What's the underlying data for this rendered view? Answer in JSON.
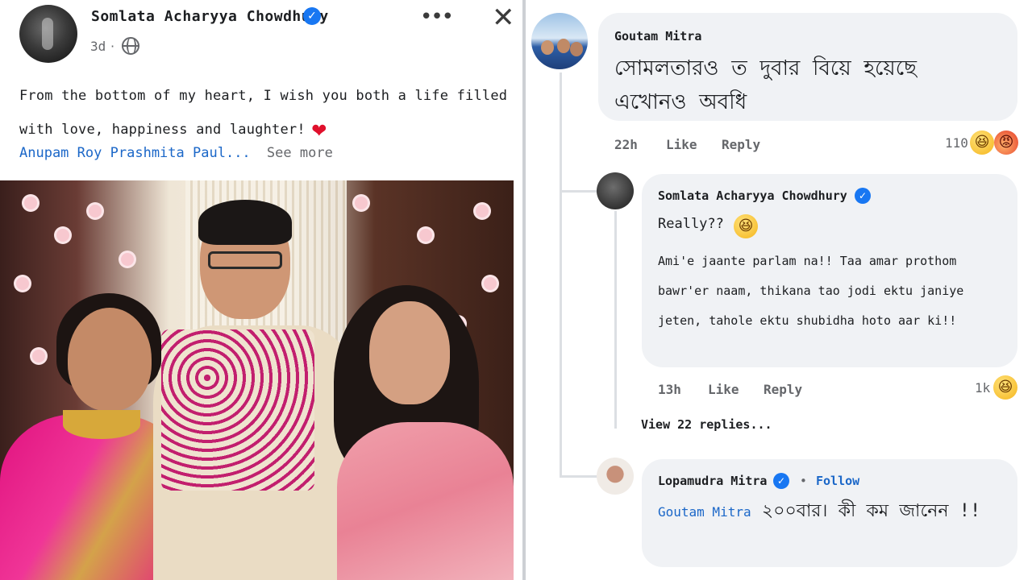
{
  "post": {
    "author": "Somlata Acharyya Chowdhury",
    "time": "3d",
    "separator": "·",
    "text_line1": "From the bottom of my heart, I wish you both a life filled",
    "text_line2": "with love, happiness and laughter!",
    "tag1": "Anupam",
    "tag2": "Roy",
    "tag3": "Prashmita",
    "tag4": "Paul...",
    "see_more": "See more",
    "more_glyph": "•••",
    "close_glyph": "✕",
    "heart_glyph": "❤",
    "verified_glyph": "✓"
  },
  "comments": [
    {
      "author": "Goutam Mitra",
      "text": "সোমলতারও ত দুবার বিয়ে হয়েছে এখোনও অবধি",
      "time": "22h",
      "like": "Like",
      "reply": "Reply",
      "reaction_count": "110",
      "reactions": [
        "haha",
        "angry"
      ]
    },
    {
      "author": "Somlata Acharyya Chowdhury",
      "text_line1": "Really??",
      "text_body": "Ami'e jaante parlam na!! Taa amar prothom bawr'er naam, thikana tao jodi ektu janiye jeten, tahole ektu shubidha hoto aar ki!!",
      "time": "13h",
      "like": "Like",
      "reply": "Reply",
      "reaction_count": "1k",
      "reactions": [
        "haha"
      ]
    },
    {
      "view_replies": "View 22 replies..."
    },
    {
      "author": "Lopamudra Mitra",
      "follow_separator": "•",
      "follow": "Follow",
      "mention": "Goutam Mitra",
      "text": "২০০বার। কী কম জানেন !!"
    }
  ],
  "emoji_glyph": "😆",
  "angry_glyph": "😡",
  "colors": {
    "link": "#1b67c8",
    "verified": "#1877f2",
    "bubble": "#f0f2f5",
    "heart": "#e0102c"
  },
  "icons": [
    "more-icon",
    "close-icon",
    "globe-icon",
    "verified-icon",
    "heart-icon",
    "haha-emoji-icon",
    "angry-emoji-icon"
  ]
}
